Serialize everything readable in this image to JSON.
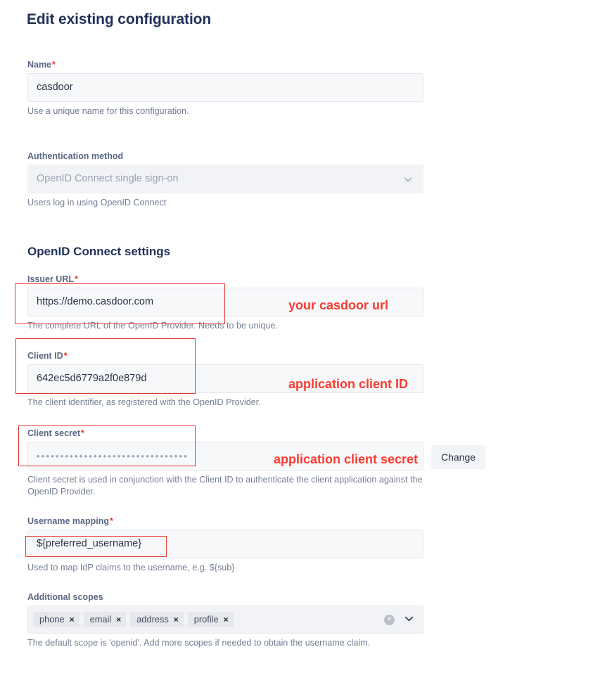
{
  "page": {
    "title": "Edit existing configuration",
    "section_title": "OpenID Connect settings"
  },
  "fields": {
    "name": {
      "label": "Name",
      "required": true,
      "value": "casdoor",
      "help": "Use a unique name for this configuration."
    },
    "auth_method": {
      "label": "Authentication method",
      "required": false,
      "value": "OpenID Connect single sign-on",
      "help": "Users log in using OpenID Connect",
      "icon": "chevron-down-icon"
    },
    "issuer_url": {
      "label": "Issuer URL",
      "required": true,
      "value": "https://demo.casdoor.com",
      "help": "The complete URL of the OpenID Provider. Needs to be unique."
    },
    "client_id": {
      "label": "Client ID",
      "required": true,
      "value": "642ec5d6779a2f0e879d",
      "help": "The client identifier, as registered with the OpenID Provider."
    },
    "client_secret": {
      "label": "Client secret",
      "required": true,
      "value": "••••••••••••••••••••••••••••••••",
      "help": "Client secret is used in conjunction with the Client ID to authenticate the client application against the OpenID Provider.",
      "change_label": "Change"
    },
    "username_mapping": {
      "label": "Username mapping",
      "required": true,
      "value": "${preferred_username}",
      "help": "Used to map IdP claims to the username, e.g. ${sub}"
    },
    "additional_scopes": {
      "label": "Additional scopes",
      "required": false,
      "help": "The default scope is 'openid'. Add more scopes if needed to obtain the username claim.",
      "chips": [
        {
          "label": "phone",
          "remove": "×"
        },
        {
          "label": "email",
          "remove": "×"
        },
        {
          "label": "address",
          "remove": "×"
        },
        {
          "label": "profile",
          "remove": "×"
        }
      ],
      "clear_icon": "×",
      "dropdown_icon": "chevron-down-icon"
    }
  },
  "annotations": [
    {
      "text": "your casdoor url"
    },
    {
      "text": "application client ID"
    },
    {
      "text": "application client secret"
    }
  ],
  "colors": {
    "annotation_red": "#fa3c32",
    "heading_navy": "#1f3159",
    "label_slate": "#5a6782",
    "required_red": "#e8392e"
  }
}
